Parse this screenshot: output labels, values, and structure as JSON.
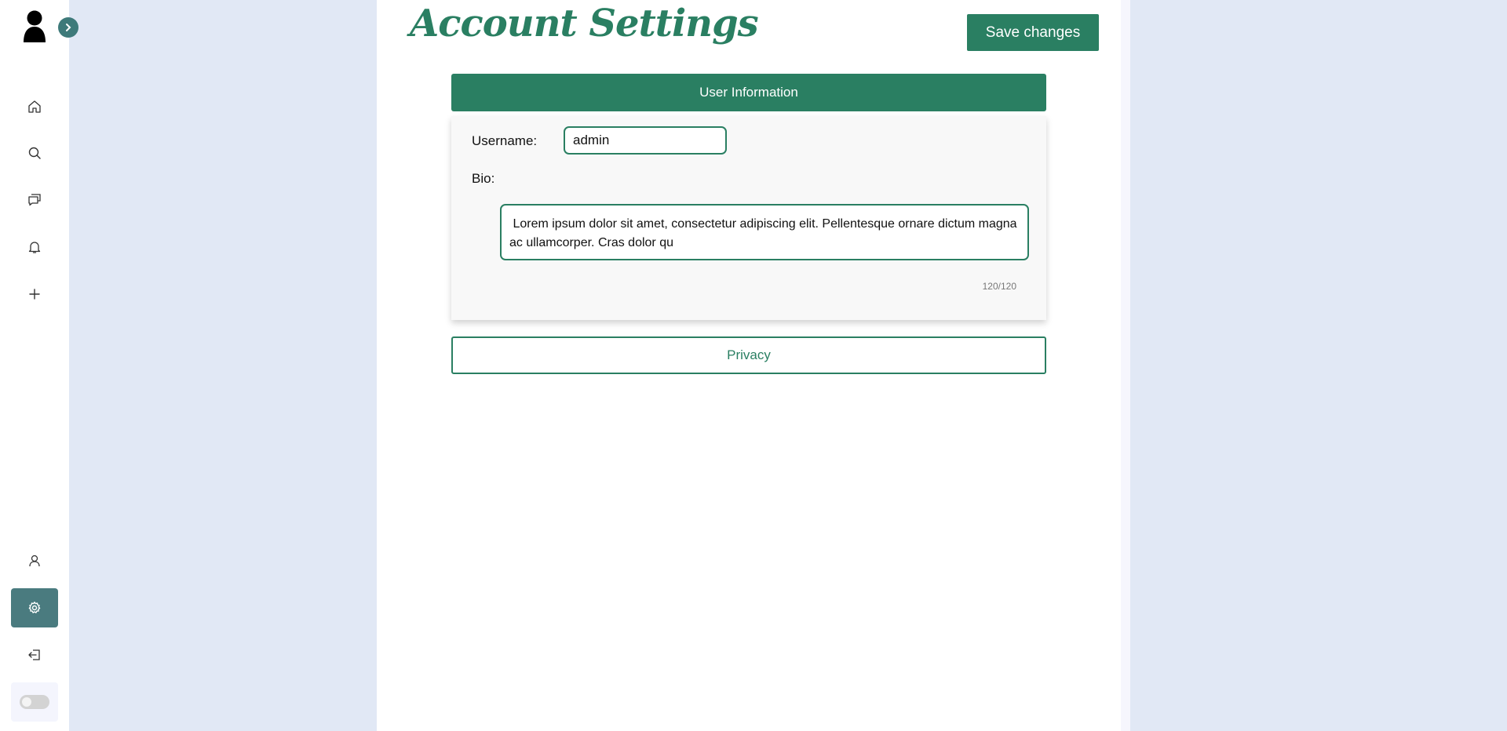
{
  "sidebar": {
    "items": [
      {
        "name": "home",
        "icon": "home-icon"
      },
      {
        "name": "search",
        "icon": "search-icon"
      },
      {
        "name": "messages",
        "icon": "chat-icon"
      },
      {
        "name": "notifications",
        "icon": "bell-icon"
      },
      {
        "name": "create",
        "icon": "plus-icon"
      },
      {
        "name": "profile",
        "icon": "user-icon"
      },
      {
        "name": "settings",
        "icon": "gear-icon",
        "active": true
      },
      {
        "name": "logout",
        "icon": "logout-icon"
      }
    ],
    "theme_toggle": {
      "on": false
    }
  },
  "header": {
    "title": "Account Settings",
    "save_label": "Save changes"
  },
  "user_info": {
    "header": "User Information",
    "username_label": "Username:",
    "username_value": "admin",
    "bio_label": "Bio:",
    "bio_value": " Lorem ipsum dolor sit amet, consectetur adipiscing elit. Pellentesque ornare dictum magna ac ullamcorper. Cras dolor qu",
    "bio_counter": "120/120"
  },
  "privacy": {
    "label": "Privacy"
  },
  "colors": {
    "accent": "#2a7f62",
    "sidebar_active": "#4a7b7f",
    "background": "#e1e8f5"
  }
}
